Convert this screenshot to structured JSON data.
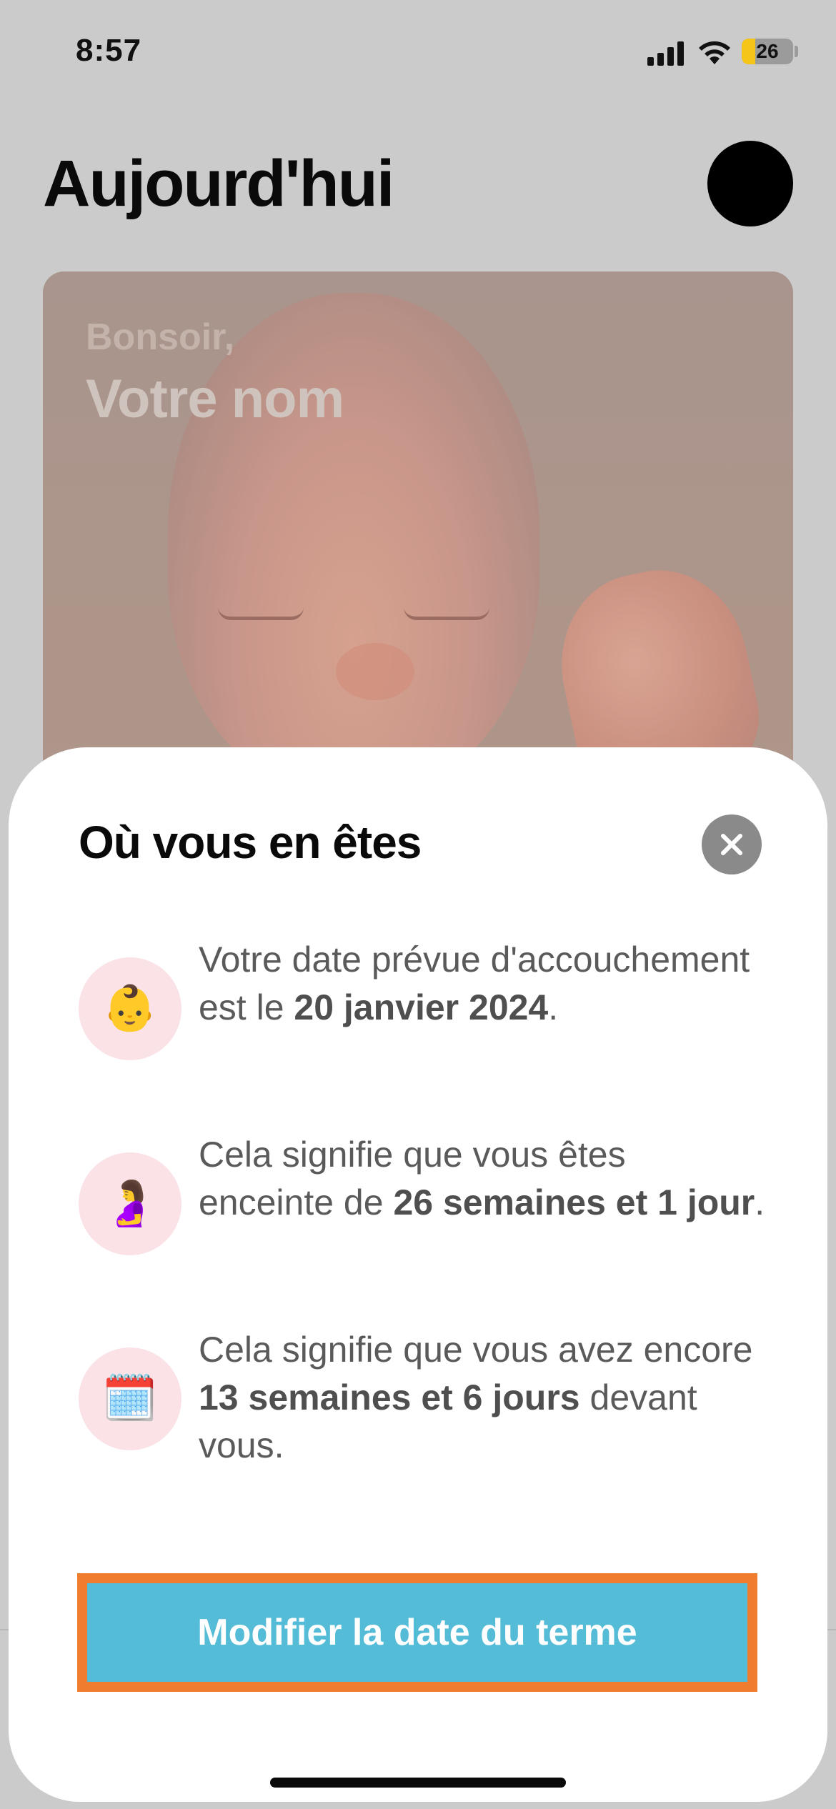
{
  "status_bar": {
    "time": "8:57",
    "battery": "26",
    "battery_level_percent": 26
  },
  "header": {
    "title": "Aujourd'hui"
  },
  "hero": {
    "greeting": "Bonsoir,",
    "name": "Votre nom"
  },
  "sheet": {
    "title": "Où vous en êtes",
    "items": [
      {
        "icon": "baby-emoji-icon",
        "emoji": "👶",
        "text_before": "Votre date prévue d'accouchement est le ",
        "text_bold": "20 janvier 2024",
        "text_after": "."
      },
      {
        "icon": "pregnant-woman-emoji-icon",
        "emoji": "🤰",
        "text_before": "Cela signifie que vous êtes enceinte de ",
        "text_bold": "26 semaines et 1 jour",
        "text_after": "."
      },
      {
        "icon": "calendar-emoji-icon",
        "emoji": "🗓️",
        "text_before": "Cela signifie que vous avez encore ",
        "text_bold": "13 semaines et 6 jours",
        "text_after": " devant vous."
      }
    ],
    "button_label": "Modifier la date du terme"
  },
  "colors": {
    "accent": "#55bcd7",
    "highlight": "#f07d2e",
    "icon_bg": "#fbe2e7"
  }
}
